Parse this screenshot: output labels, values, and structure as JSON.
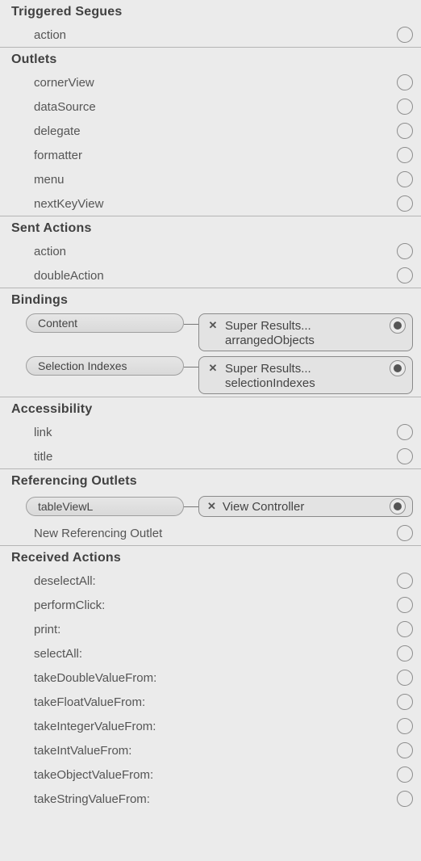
{
  "sections": {
    "triggeredSegues": {
      "title": "Triggered Segues",
      "items": [
        "action"
      ]
    },
    "outlets": {
      "title": "Outlets",
      "items": [
        "cornerView",
        "dataSource",
        "delegate",
        "formatter",
        "menu",
        "nextKeyView"
      ]
    },
    "sentActions": {
      "title": "Sent Actions",
      "items": [
        "action",
        "doubleAction"
      ]
    },
    "bindings": {
      "title": "Bindings",
      "items": [
        {
          "name": "Content",
          "destTitle": "Super Results...",
          "destSub": "arrangedObjects"
        },
        {
          "name": "Selection Indexes",
          "destTitle": "Super Results...",
          "destSub": "selectionIndexes"
        }
      ]
    },
    "accessibility": {
      "title": "Accessibility",
      "items": [
        "link",
        "title"
      ]
    },
    "referencingOutlets": {
      "title": "Referencing Outlets",
      "connected": {
        "name": "tableViewL",
        "dest": "View Controller"
      },
      "newLabel": "New Referencing Outlet"
    },
    "receivedActions": {
      "title": "Received Actions",
      "items": [
        "deselectAll:",
        "performClick:",
        "print:",
        "selectAll:",
        "takeDoubleValueFrom:",
        "takeFloatValueFrom:",
        "takeIntegerValueFrom:",
        "takeIntValueFrom:",
        "takeObjectValueFrom:",
        "takeStringValueFrom:"
      ]
    }
  }
}
